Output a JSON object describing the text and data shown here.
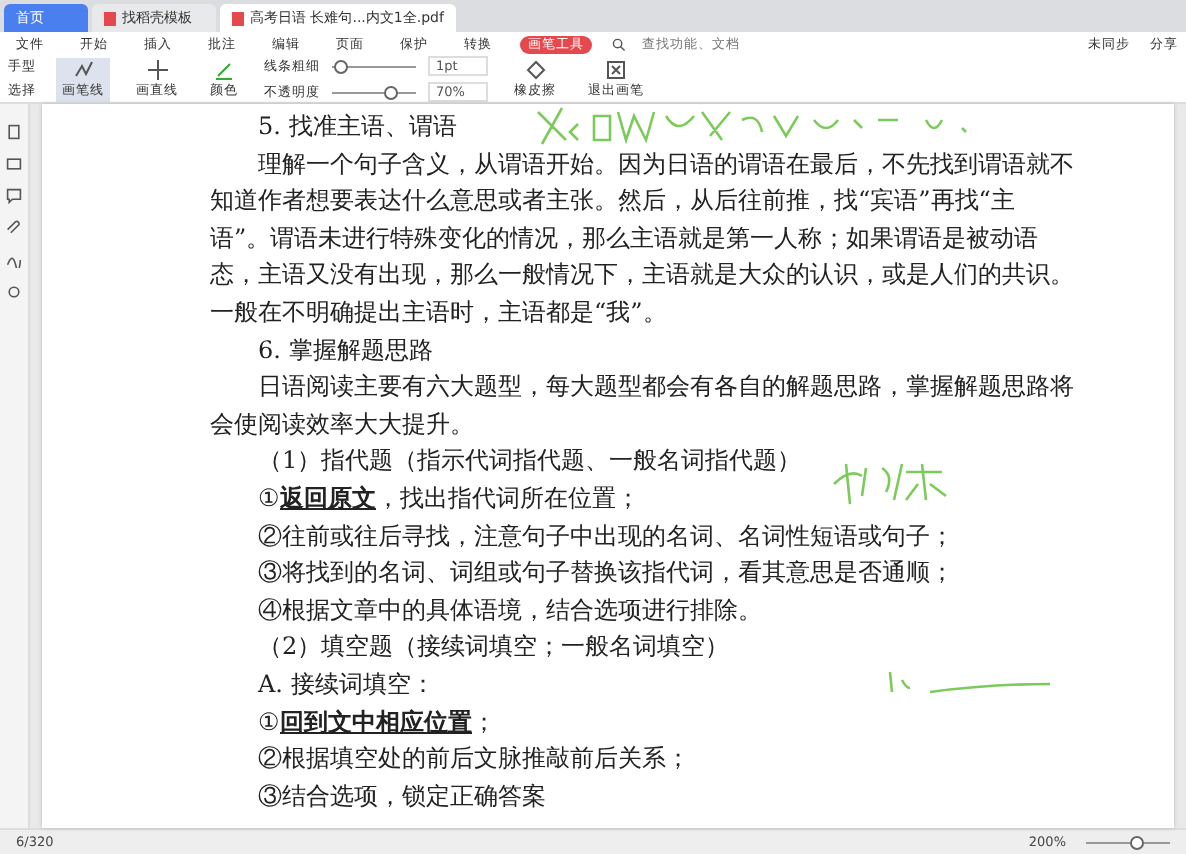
{
  "tabs": [
    {
      "label": "首页",
      "kind": "home",
      "selected": false
    },
    {
      "label": "找稻壳模板",
      "kind": "doc",
      "selected": false
    },
    {
      "label": "高考日语 长难句...内文1全.pdf",
      "kind": "doc",
      "selected": true
    }
  ],
  "menu": [
    {
      "label": "文件",
      "selected": false
    },
    {
      "label": "开始",
      "selected": false
    },
    {
      "label": "插入",
      "selected": false
    },
    {
      "label": "批注",
      "selected": false
    },
    {
      "label": "编辑",
      "selected": false
    },
    {
      "label": "页面",
      "selected": false
    },
    {
      "label": "保护",
      "selected": false
    },
    {
      "label": "转换",
      "selected": false
    },
    {
      "label": "画笔工具",
      "selected": true
    }
  ],
  "search": {
    "placeholder": "查找功能、文档"
  },
  "sync": "未同步",
  "share": "分享",
  "tools": {
    "hand": "手型",
    "select": "选择",
    "pen": "画笔线",
    "line": "画直线",
    "color_label": "颜色",
    "thickness": "线条粗细",
    "opacity": "不透明度",
    "thickness_value": "1pt",
    "thickness_slider": {
      "level": 0.1
    },
    "opacity_value": "70%",
    "opacity_slider": {
      "level": 0.7
    },
    "eraser": "橡皮擦",
    "exit": "退出画笔"
  },
  "document": [
    {
      "kind": "heading",
      "text": "5. 找准主语、谓语"
    },
    {
      "kind": "paragraph",
      "text": "理解一个句子含义，从谓语开始。因为日语的谓语在最后，不先找到谓语就不知道作者想要表达什么意思或者主张。然后，从后往前推，找“宾语”再找“主语”。谓语未进行特殊变化的情况，那么主语就是第一人称；如果谓语是被动语态，主语又没有出现，那么一般情况下，主语就是大众的认识，或是人们的共识。一般在不明确提出主语时，主语都是“我”。"
    },
    {
      "kind": "heading",
      "text": "6. 掌握解题思路"
    },
    {
      "kind": "paragraph",
      "text": "日语阅读主要有六大题型，每大题型都会有各自的解题思路，掌握解题思路将会使阅读效率大大提升。"
    },
    {
      "kind": "heading",
      "text": "（1）指代题（指示代词指代题、一般名词指代题）"
    },
    {
      "kind": "item",
      "text": "①**返回原文**，找出指代词所在位置；"
    },
    {
      "kind": "item",
      "text": "②往前或往后寻找，注意句子中出现的名词、名词性短语或句子；"
    },
    {
      "kind": "item",
      "text": "③将找到的名词、词组或句子替换该指代词，看其意思是否通顺；"
    },
    {
      "kind": "item",
      "text": "④根据文章中的具体语境，结合选项进行排除。"
    },
    {
      "kind": "heading",
      "text": "（2）填空题（接续词填空；一般名词填空）"
    },
    {
      "kind": "item",
      "text": "A. 接续词填空："
    },
    {
      "kind": "item",
      "text": "①**回到文中相应位置**；"
    },
    {
      "kind": "item",
      "text": "②根据填空处的前后文脉推敲前后关系；"
    },
    {
      "kind": "item",
      "text": "③结合选项，锁定正确答案"
    }
  ],
  "status": {
    "page": "6/320",
    "zoom": "200%",
    "zoom_slider": {
      "level": 0.6
    }
  }
}
